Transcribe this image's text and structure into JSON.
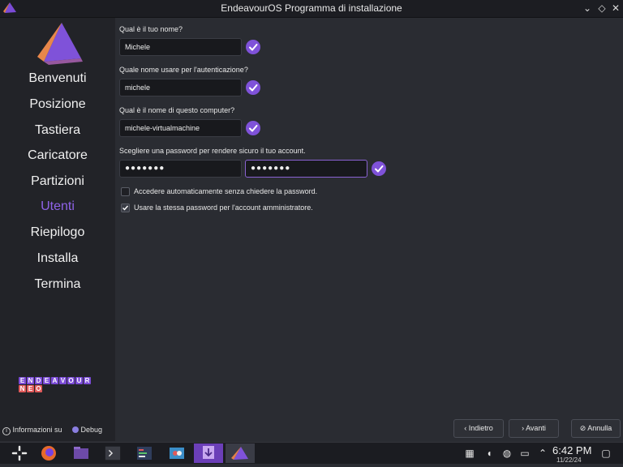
{
  "window": {
    "title": "EndeavourOS Programma di installazione"
  },
  "sidebar": {
    "steps": [
      {
        "label": "Benvenuti"
      },
      {
        "label": "Posizione"
      },
      {
        "label": "Tastiera"
      },
      {
        "label": "Caricatore"
      },
      {
        "label": "Partizioni"
      },
      {
        "label": "Utenti"
      },
      {
        "label": "Riepilogo"
      },
      {
        "label": "Installa"
      },
      {
        "label": "Termina"
      }
    ],
    "active_step": "Utenti",
    "brand_letters_row1": [
      "E",
      "N",
      "D",
      "E",
      "A",
      "V",
      "O",
      "U",
      "R"
    ],
    "brand_letters_row2": [
      "N",
      "E",
      "O"
    ],
    "about_label": "Informazioni su",
    "debug_label": "Debug"
  },
  "form": {
    "name_label": "Qual è il tuo nome?",
    "name_value": "Michele",
    "login_label": "Quale nome usare per l'autenticazione?",
    "login_value": "michele",
    "host_label": "Qual è il nome di questo computer?",
    "host_value": "michele-virtualmachine",
    "password_label": "Scegliere una password per rendere sicuro il tuo account.",
    "password_value": "●●●●●●●",
    "password_repeat_value": "●●●●●●●",
    "autologin_label": "Accedere automaticamente senza chiedere la password.",
    "autologin_checked": false,
    "reuse_password_label": "Usare la stessa password per l'account amministratore.",
    "reuse_password_checked": true
  },
  "buttons": {
    "back_label": "Indietro",
    "next_label": "Avanti",
    "cancel_label": "Annulla"
  },
  "taskbar": {
    "time": "6:42 PM",
    "date": "11/22/24"
  },
  "colors": {
    "accent": "#7f52d9",
    "active_step": "#8f63e8",
    "brand_purple": "#7b4bd6",
    "brand_red": "#e05a5a"
  }
}
